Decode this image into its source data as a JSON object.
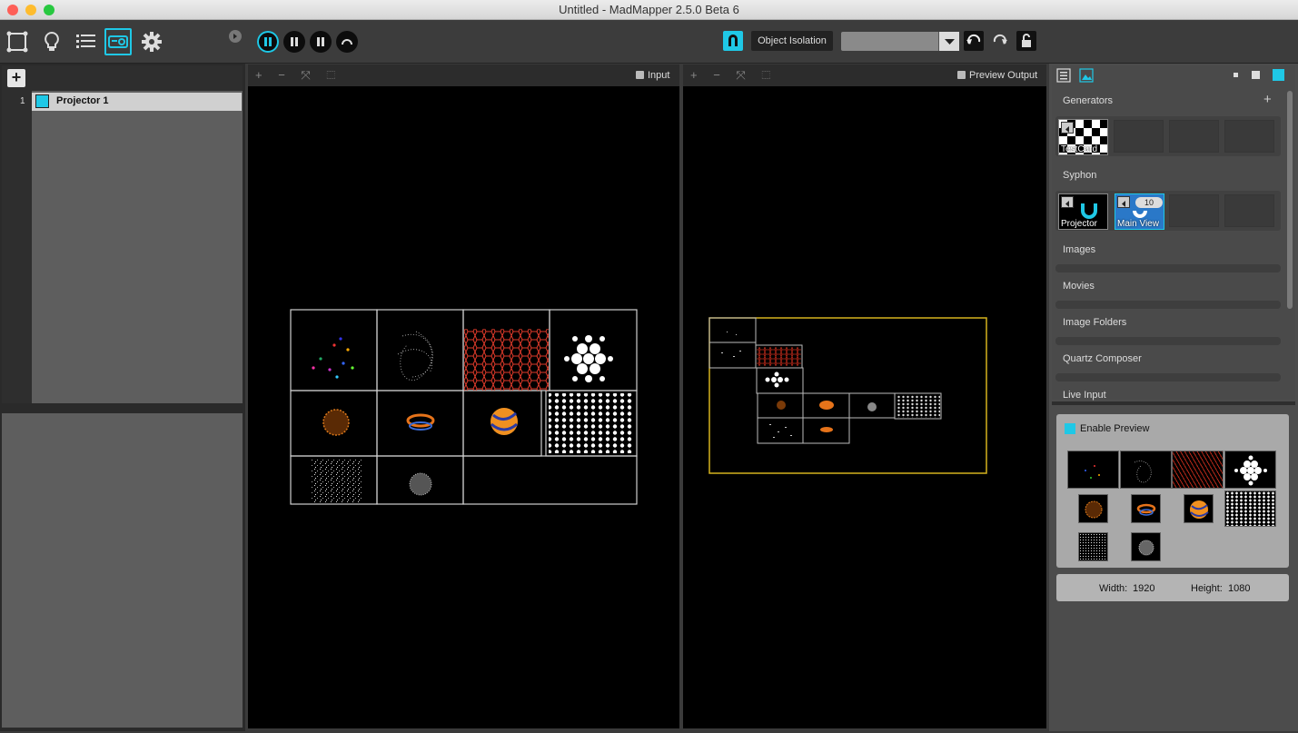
{
  "window": {
    "title": "Untitled - MadMapper 2.5.0 Beta 6"
  },
  "toolbar": {
    "object_isolation_label": "Object Isolation",
    "selector_value": ""
  },
  "projectors": {
    "add_label": "+",
    "items": [
      {
        "index": "1",
        "name": "Projector 1",
        "color": "#1fc8e6"
      }
    ]
  },
  "viewports": {
    "input_label": "Input",
    "output_label": "Preview Output",
    "tools": "+ − ⤧ ⬚"
  },
  "library": {
    "add_label": "+",
    "sections": {
      "generators": "Generators",
      "syphon": "Syphon",
      "images": "Images",
      "movies": "Movies",
      "image_folders": "Image Folders",
      "quartz_composer": "Quartz Composer",
      "live_input": "Live Input"
    },
    "generators": [
      {
        "name": "TestCard"
      }
    ],
    "syphon": [
      {
        "name": "Projector"
      },
      {
        "name": "Main View",
        "badge": "10"
      }
    ]
  },
  "preview": {
    "enable_label": "Enable Preview",
    "width_label": "Width:",
    "width_value": "1920",
    "height_label": "Height:",
    "height_value": "1080"
  },
  "colors": {
    "accent": "#1fc8e6",
    "output_frame": "#d6b21e"
  }
}
